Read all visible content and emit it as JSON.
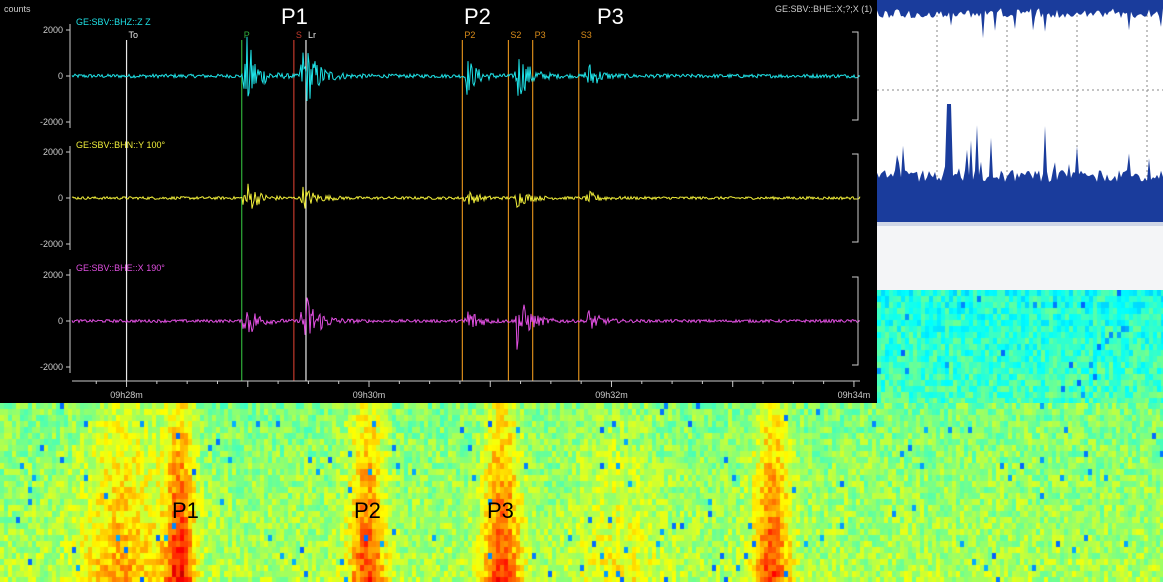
{
  "colors": {
    "z": "#1fe3e8",
    "y": "#f0ee3a",
    "x": "#e04fe0",
    "bg": "#000000",
    "axis": "#cccccc",
    "marker_green": "#2fae3a",
    "marker_red": "#c0392b",
    "marker_white": "#e8e8e8",
    "marker_orange": "#d98c1a",
    "hist_fill": "#1a3c9c"
  },
  "seismogram": {
    "counts_label": "counts",
    "right_title": "GE:SBV::BHE::X;?;X (1)",
    "overlay_labels": [
      "P1",
      "P2",
      "P3"
    ],
    "phase_markers": [
      {
        "label": "To",
        "time_min": 28.0,
        "color": "white"
      },
      {
        "label": "P",
        "time_min": 28.95,
        "color": "green"
      },
      {
        "label": "S",
        "time_min": 29.38,
        "color": "red"
      },
      {
        "label": "Lr",
        "time_min": 29.48,
        "color": "white"
      },
      {
        "label": "P2",
        "time_min": 30.77,
        "color": "orange"
      },
      {
        "label": "S2",
        "time_min": 31.15,
        "color": "orange"
      },
      {
        "label": "P3",
        "time_min": 31.35,
        "color": "orange"
      },
      {
        "label": "S3",
        "time_min": 31.73,
        "color": "orange"
      }
    ],
    "bursts": [
      {
        "t": 28.98,
        "amp": 1.0,
        "w": 0.08
      },
      {
        "t": 29.45,
        "amp": 0.9,
        "w": 0.1
      },
      {
        "t": 30.8,
        "amp": 0.45,
        "w": 0.08
      },
      {
        "t": 31.22,
        "amp": 0.6,
        "w": 0.09
      },
      {
        "t": 31.8,
        "amp": 0.35,
        "w": 0.08
      }
    ]
  },
  "chart_data": {
    "type": "line",
    "x_ticks": [
      "09h28m",
      "09h30m",
      "09h32m",
      "09h34m"
    ],
    "x_range_min": [
      27.55,
      34.05
    ],
    "y_ticks": [
      "2000",
      "0",
      "-2000"
    ],
    "ylim": [
      -2200,
      2200
    ],
    "series": [
      {
        "name": "GE:SBV::BHZ::Z Z",
        "key": "z"
      },
      {
        "name": "GE:SBV::BHN::Y 100°",
        "key": "y"
      },
      {
        "name": "GE:SBV::BHE::X 190°",
        "key": "x"
      }
    ]
  },
  "spectrogram_labels": [
    "P1",
    "P2",
    "P3"
  ]
}
